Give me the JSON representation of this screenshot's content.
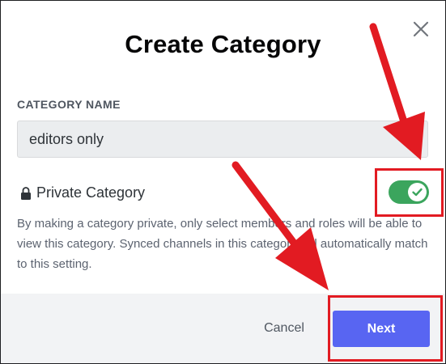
{
  "dialog": {
    "title": "Create Category",
    "close_icon": "close-icon"
  },
  "category_name": {
    "label": "CATEGORY NAME",
    "value": "editors only"
  },
  "private_category": {
    "label": "Private Category",
    "icon": "lock-icon",
    "enabled": true,
    "toggle_icon": "checkmark-icon",
    "description": "By making a category private, only select members and roles will be able to view this category. Synced channels in this category will automatically match to this setting."
  },
  "footer": {
    "cancel_label": "Cancel",
    "next_label": "Next"
  },
  "annotations": {
    "color": "#e21b22",
    "items": [
      "arrow-to-toggle",
      "arrow-to-next",
      "highlight-toggle",
      "highlight-next"
    ]
  },
  "colors": {
    "primary_button": "#5865f2",
    "toggle_on": "#3ba55d",
    "footer_bg": "#f2f3f5"
  }
}
